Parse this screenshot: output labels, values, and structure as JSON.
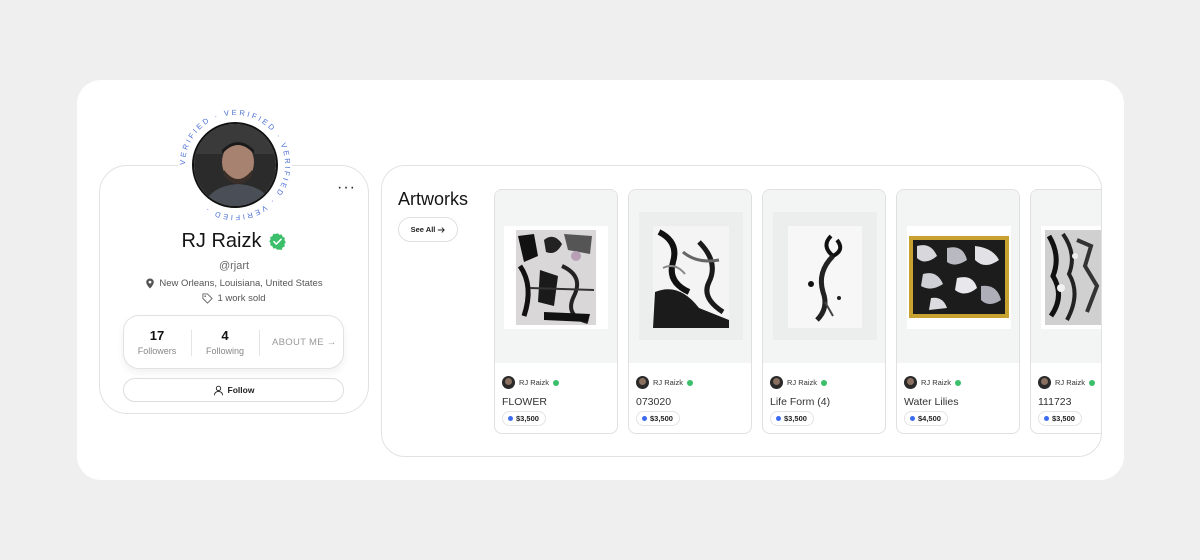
{
  "profile": {
    "ring_text": "VERIFIED · VERIFIED · VERIFIED · VERIFIED ·",
    "more_label": "···",
    "name": "RJ Raizk",
    "handle": "@rjart",
    "location": "New Orleans, Louisiana, United States",
    "works_sold": "1 work sold",
    "stats": {
      "followers_count": "17",
      "followers_label": "Followers",
      "following_count": "4",
      "following_label": "Following",
      "about_label": "ABOUT ME →"
    },
    "follow_label": "Follow"
  },
  "artworks": {
    "title": "Artworks",
    "see_all_label": "See All",
    "items": [
      {
        "artist": "RJ Raizk",
        "title": "FLOWER",
        "price": "$3,500"
      },
      {
        "artist": "RJ Raizk",
        "title": "073020",
        "price": "$3,500"
      },
      {
        "artist": "RJ Raizk",
        "title": "Life Form (4)",
        "price": "$3,500"
      },
      {
        "artist": "RJ Raizk",
        "title": "Water Lilies",
        "price": "$4,500"
      },
      {
        "artist": "RJ Raizk",
        "title": "111723",
        "price": "$3,500"
      }
    ]
  },
  "colors": {
    "verified_green": "#3cbf6a",
    "ring_blue": "#4b6fd6",
    "price_dot_blue": "#3d6bef"
  },
  "icons": [
    "more-icon",
    "verified-badge-icon",
    "location-pin-icon",
    "tag-icon",
    "user-icon",
    "arrow-right-icon"
  ]
}
